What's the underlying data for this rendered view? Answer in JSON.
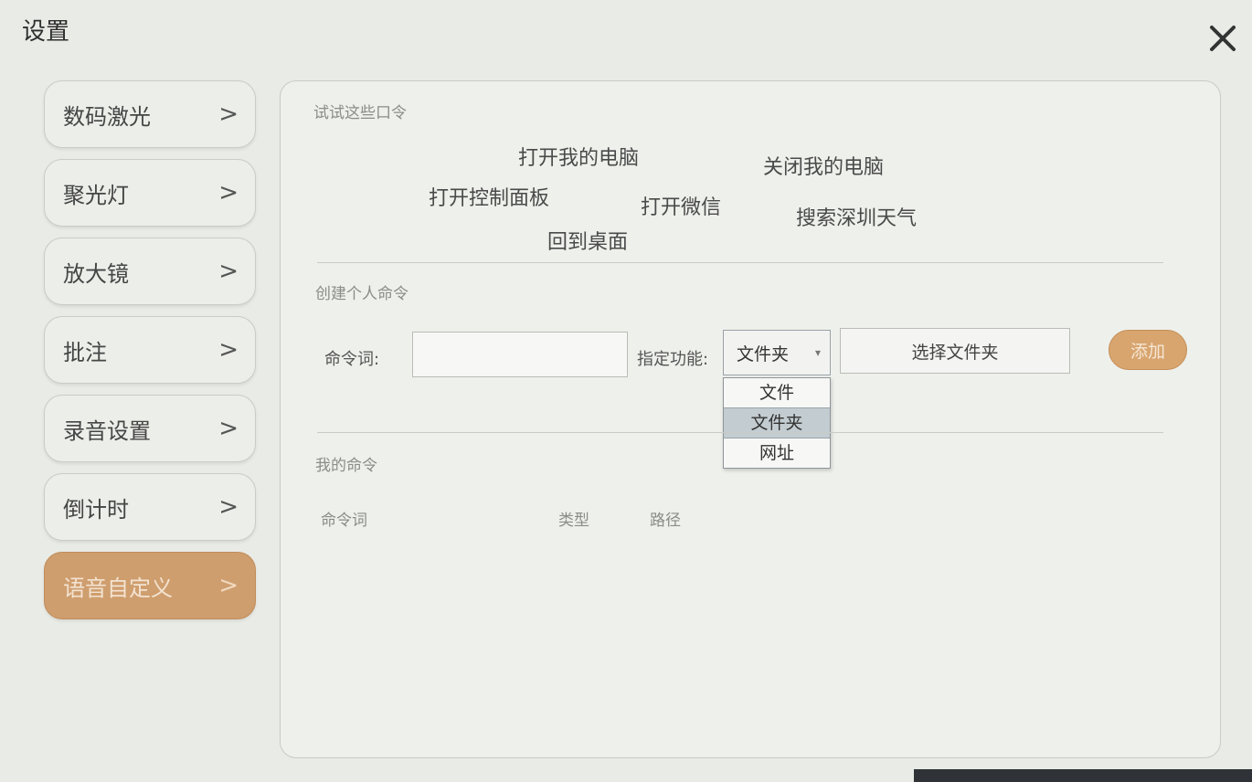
{
  "window": {
    "title": "设置",
    "close_icon": "close-icon"
  },
  "sidebar": {
    "items": [
      {
        "label": "数码激光",
        "chevron": ">"
      },
      {
        "label": "聚光灯",
        "chevron": ">"
      },
      {
        "label": "放大镜",
        "chevron": ">"
      },
      {
        "label": "批注",
        "chevron": ">"
      },
      {
        "label": "录音设置",
        "chevron": ">"
      },
      {
        "label": "倒计时",
        "chevron": ">"
      },
      {
        "label": "语音自定义",
        "chevron": ">",
        "active": true
      }
    ],
    "active_color": "#cf9e6e"
  },
  "try_commands": {
    "title": "试试这些口令",
    "items": [
      "打开我的电脑",
      "关闭我的电脑",
      "打开控制面板",
      "打开微信",
      "搜索深圳天气",
      "回到桌面"
    ]
  },
  "create_command": {
    "title": "创建个人命令",
    "name_label": "命令词:",
    "name_value": "",
    "function_label": "指定功能:",
    "function_selected": "文件夹",
    "function_options": [
      "文件",
      "文件夹",
      "网址"
    ],
    "choose_label": "选择文件夹",
    "add_label": "添加",
    "add_color": "#d8a56f"
  },
  "my_commands": {
    "title": "我的命令",
    "columns": [
      "命令词",
      "类型",
      "路径"
    ]
  }
}
